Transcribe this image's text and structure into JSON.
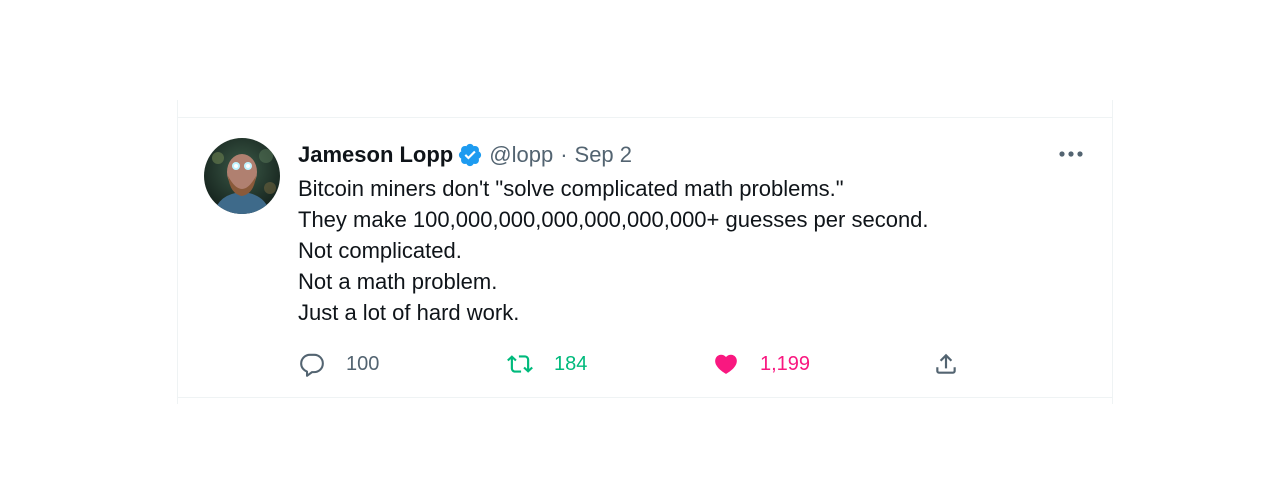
{
  "tweet": {
    "author_name": "Jameson Lopp",
    "handle": "@lopp",
    "separator": "·",
    "date": "Sep 2",
    "lines": [
      "Bitcoin miners don't \"solve complicated math problems.\"",
      "They make 100,000,000,000,000,000,000+ guesses per second.",
      "Not complicated.",
      "Not a math problem.",
      "Just a lot of hard work."
    ],
    "replies": "100",
    "retweets": "184",
    "likes": "1,199",
    "liked": true
  },
  "icons": {
    "verified": "verified-badge-icon",
    "more": "more-options-icon",
    "reply": "reply-icon",
    "retweet": "retweet-icon",
    "like": "heart-icon",
    "share": "share-icon"
  },
  "colors": {
    "verified": "#1d9bf0",
    "secondary_text": "#536471",
    "retweet": "#00ba7c",
    "like": "#f91880",
    "border": "#eff3f4"
  }
}
